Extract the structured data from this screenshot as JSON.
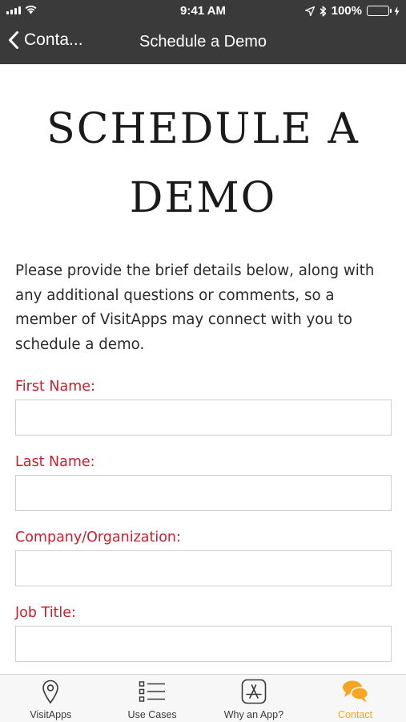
{
  "status_bar": {
    "time": "9:41 AM",
    "battery_percent": "100%",
    "battery_level": 1.0
  },
  "nav": {
    "back_label": "Conta...",
    "title": "Schedule a Demo"
  },
  "page": {
    "heading_line1": "SCHEDULE A",
    "heading_line2": "DEMO",
    "intro": "Please provide the brief details below, along with any additional questions or comments, so a member of VisitApps may connect with you to schedule a demo."
  },
  "form": {
    "fields": [
      {
        "label": "First Name:",
        "value": ""
      },
      {
        "label": "Last Name:",
        "value": ""
      },
      {
        "label": "Company/Organization:",
        "value": ""
      },
      {
        "label": "Job Title:",
        "value": ""
      }
    ]
  },
  "tabs": [
    {
      "label": "VisitApps",
      "icon": "map-pin-icon"
    },
    {
      "label": "Use Cases",
      "icon": "list-icon"
    },
    {
      "label": "Why an App?",
      "icon": "app-store-icon"
    },
    {
      "label": "Contact",
      "icon": "chat-bubbles-icon",
      "active": true
    }
  ],
  "colors": {
    "label_red": "#c8202f",
    "nav_bg": "#3a3a3a",
    "active_tab": "#f5a623",
    "battery_green": "#4cd964"
  }
}
